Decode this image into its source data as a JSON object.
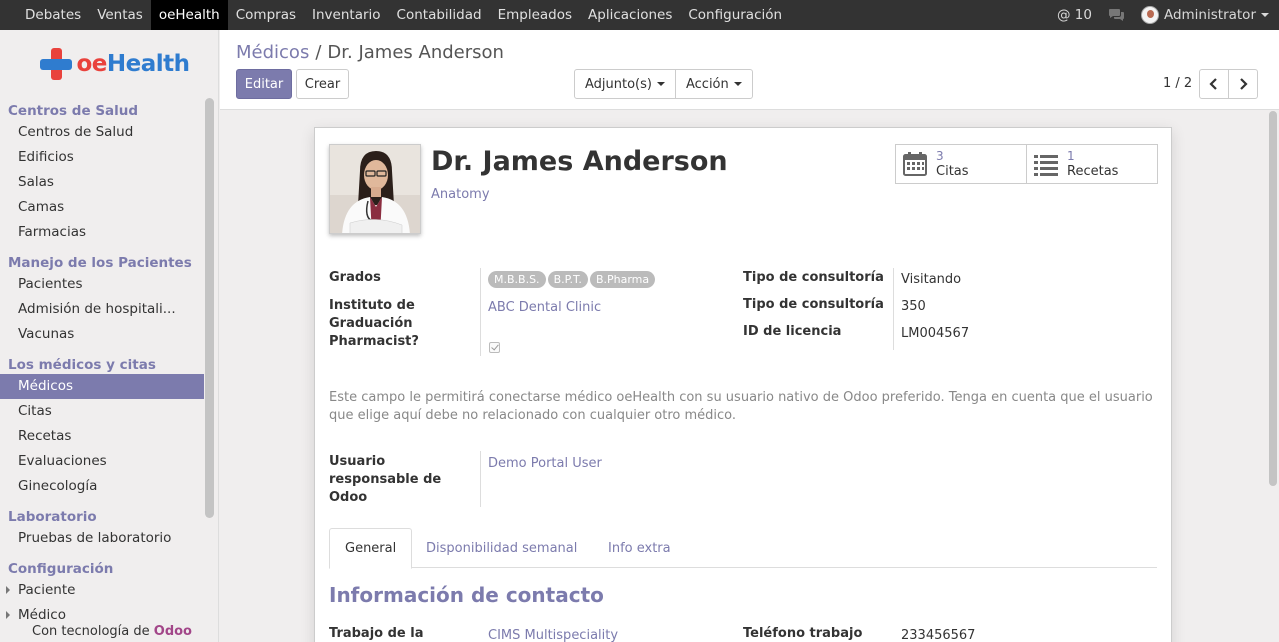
{
  "topbar": {
    "menu": [
      "Debates",
      "Ventas",
      "oeHealth",
      "Compras",
      "Inventario",
      "Contabilidad",
      "Empleados",
      "Aplicaciones",
      "Configuración"
    ],
    "mentions": "@ 10",
    "user": "Administrator"
  },
  "sidebar": {
    "logo": {
      "part1": "oe",
      "part2": "Health"
    },
    "sections": [
      {
        "title": "Centros de Salud",
        "items": [
          "Centros de Salud",
          "Edificios",
          "Salas",
          "Camas",
          "Farmacias"
        ]
      },
      {
        "title": "Manejo de los Pacientes",
        "items": [
          "Pacientes",
          "Admisión de hospitali...",
          "Vacunas"
        ]
      },
      {
        "title": "Los médicos y citas",
        "items": [
          "Médicos",
          "Citas",
          "Recetas",
          "Evaluaciones",
          "Ginecología"
        ]
      },
      {
        "title": "Laboratorio",
        "items": [
          "Pruebas de laboratorio"
        ]
      },
      {
        "title": "Configuración",
        "items": [
          "Paciente",
          "Médico"
        ]
      }
    ],
    "footer_text": "Con tecnología de",
    "footer_brand": "Odoo"
  },
  "control_panel": {
    "breadcrumb_parent": "Médicos",
    "breadcrumb_sep": "/",
    "breadcrumb_current": "Dr. James Anderson",
    "edit_label": "Editar",
    "create_label": "Crear",
    "attachments_label": "Adjunto(s)",
    "action_label": "Acción",
    "pager": "1 / 2"
  },
  "form": {
    "name": "Dr. James Anderson",
    "specialty": "Anatomy",
    "smart_buttons": [
      {
        "count": "3",
        "label": "Citas",
        "icon": "calendar-icon"
      },
      {
        "count": "1",
        "label": "Recetas",
        "icon": "list-icon"
      }
    ],
    "left_fields": {
      "degrees_label": "Grados",
      "degrees": [
        "M.B.B.S.",
        "B.P.T.",
        "B.Pharma"
      ],
      "institute_label": "Instituto de Graduación",
      "institute": "ABC Dental Clinic",
      "pharmacist_label": "Pharmacist?",
      "pharmacist_checked": true
    },
    "right_fields": [
      {
        "label": "Tipo de consultoría",
        "value": "Visitando"
      },
      {
        "label": "Tipo de consultoría",
        "value": "350"
      },
      {
        "label": "ID de licencia",
        "value": "LM004567"
      }
    ],
    "note": "Este campo le permitirá conectarse médico oeHealth con su usuario nativo de Odoo preferido. Tenga en cuenta que el usuario que elige aquí debe no relacionado con cualquier otro médico.",
    "odoo_user_label": "Usuario responsable de Odoo",
    "odoo_user": "Demo Portal User",
    "tabs": [
      "General",
      "Disponibilidad semanal",
      "Info extra"
    ],
    "section_title": "Información de contacto",
    "bottom_left_label": "Trabajo de la",
    "bottom_left_value": "CIMS Multispeciality",
    "bottom_right_label": "Teléfono trabajo",
    "bottom_right_value": "233456567"
  },
  "colors": {
    "accent": "#7c7bad",
    "topbar": "#333333",
    "logo_red": "#e9423c",
    "logo_blue": "#2f7ccf"
  }
}
